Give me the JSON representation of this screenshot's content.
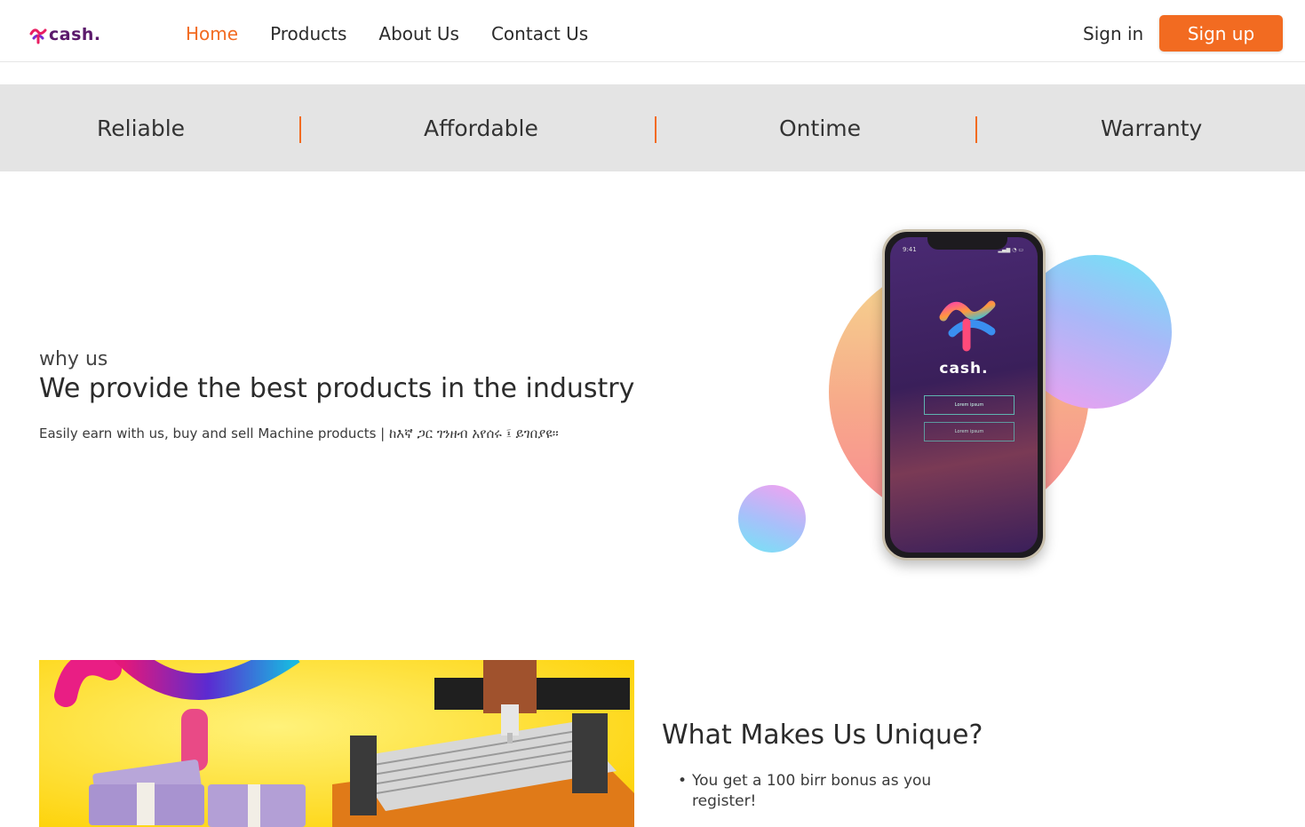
{
  "header": {
    "logo_text": "cash.",
    "nav": [
      "Home",
      "Products",
      "About Us",
      "Contact Us"
    ],
    "active_nav": "Home",
    "sign_in": "Sign in",
    "sign_up": "Sign up"
  },
  "features": [
    "Reliable",
    "Affordable",
    "Ontime",
    "Warranty"
  ],
  "hero": {
    "eyebrow": "why us",
    "headline": "We provide the best products in the industry",
    "tagline": "Easily earn with us, buy and sell Machine products | ከእኛ ጋር ገንዘብ አየሰሩ ፤ ይገበያዩ።"
  },
  "phone": {
    "time": "9:41",
    "app_name": "cash.",
    "button_1": "Lorem ipsum",
    "button_2": "Lorem ipsum"
  },
  "unique": {
    "title": "What Makes Us Unique?",
    "items": [
      "You get a 100 birr bonus as you register!"
    ]
  },
  "colors": {
    "accent": "#f26b21",
    "band_bg": "#e4e4e4",
    "promo_bg": "#fdd000"
  }
}
